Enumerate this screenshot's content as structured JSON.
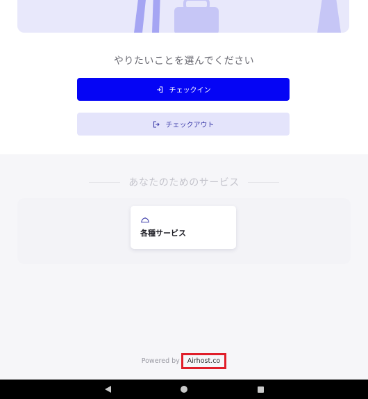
{
  "main": {
    "prompt": "やりたいことを選んでください",
    "checkin_button": {
      "label": "チェックイン",
      "icon": "login-icon"
    },
    "checkout_button": {
      "label": "チェックアウト",
      "icon": "logout-icon"
    }
  },
  "services": {
    "title": "あなたのためのサービス",
    "cards": [
      {
        "label": "各種サービス",
        "icon": "service-bell-icon"
      }
    ]
  },
  "footer": {
    "powered_by": "Powered by",
    "link": "Airhost.co"
  },
  "colors": {
    "primary": "#0505f5",
    "secondary_bg": "#e4e4fb",
    "highlight": "#e01e2a"
  }
}
